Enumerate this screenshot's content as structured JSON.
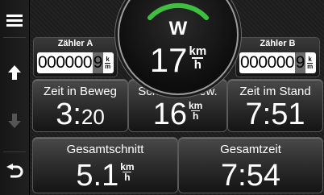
{
  "nav": {
    "menu_icon": "hamburger-menu-icon",
    "up_icon": "arrow-up-icon",
    "down_icon": "arrow-down-icon",
    "back_icon": "back-arrow-icon"
  },
  "compass": {
    "heading": "W",
    "accent_color": "#3fbf3f"
  },
  "speed": {
    "value": "17",
    "unit_top": "km",
    "unit_bottom": "h"
  },
  "trip_a": {
    "title": "Zähler A",
    "digits": "000000",
    "last_digit": "9",
    "unit_top": "k",
    "unit_bottom": "m"
  },
  "trip_b": {
    "title": "Zähler B",
    "digits": "000000",
    "last_digit": "9",
    "unit_top": "k",
    "unit_bottom": "m"
  },
  "fields": {
    "moving_time": {
      "label": "Zeit in Beweg",
      "value_main": "3:",
      "value_small": "20"
    },
    "moving_avg": {
      "label": "Schnitt in Bew.",
      "value": "16",
      "unit_top": "km",
      "unit_bottom": "h"
    },
    "stopped_time": {
      "label": "Zeit im Stand",
      "value": "7:51"
    },
    "overall_avg": {
      "label": "Gesamtschnitt",
      "value": "5.1",
      "unit_top": "km",
      "unit_bottom": "h"
    },
    "total_time": {
      "label": "Gesamtzeit",
      "value": "7:54"
    }
  }
}
